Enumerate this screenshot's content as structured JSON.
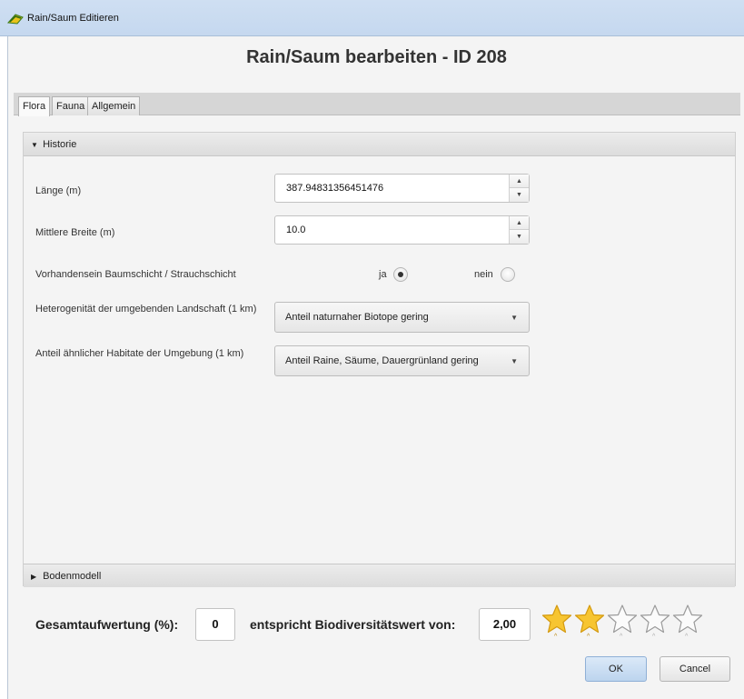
{
  "window": {
    "title": "Rain/Saum Editieren"
  },
  "dialog": {
    "heading": "Rain/Saum bearbeiten - ID 208"
  },
  "tabs": [
    {
      "label": "Flora",
      "active": true
    },
    {
      "label": "Fauna",
      "active": false
    },
    {
      "label": "Allgemein",
      "active": false
    }
  ],
  "sections": {
    "historie": {
      "label": "Historie",
      "expanded": true
    },
    "bodenmodell": {
      "label": "Bodenmodell",
      "expanded": false
    }
  },
  "form": {
    "laenge": {
      "label": "Länge (m)",
      "value": "387.94831356451476"
    },
    "breite": {
      "label": "Mittlere Breite (m)",
      "value": "10.0"
    },
    "baumschicht": {
      "label": "Vorhandensein Baumschicht / Strauchschicht",
      "option_yes": "ja",
      "option_no": "nein",
      "selected": "ja"
    },
    "heterogenitaet": {
      "label": "Heterogenität der umgebenden Landschaft (1 km)",
      "value": "Anteil naturnaher Biotope gering"
    },
    "habitate": {
      "label": "Anteil ähnlicher Habitate der Umgebung (1 km)",
      "value": "Anteil Raine, Säume, Dauergrünland gering"
    }
  },
  "footer": {
    "gesamt_label": "Gesamtaufwertung (%):",
    "gesamt_value": "0",
    "biodiv_label": "entspricht Biodiversitätswert von:",
    "biodiv_value": "2,00",
    "rating": {
      "filled": 2,
      "total": 5
    }
  },
  "buttons": {
    "ok": "OK",
    "cancel": "Cancel"
  },
  "colors": {
    "star_fill": "#f7c531",
    "star_stroke": "#d49a10",
    "star_empty_stroke": "#9a9a9a",
    "accent": "#bcd4ee"
  }
}
